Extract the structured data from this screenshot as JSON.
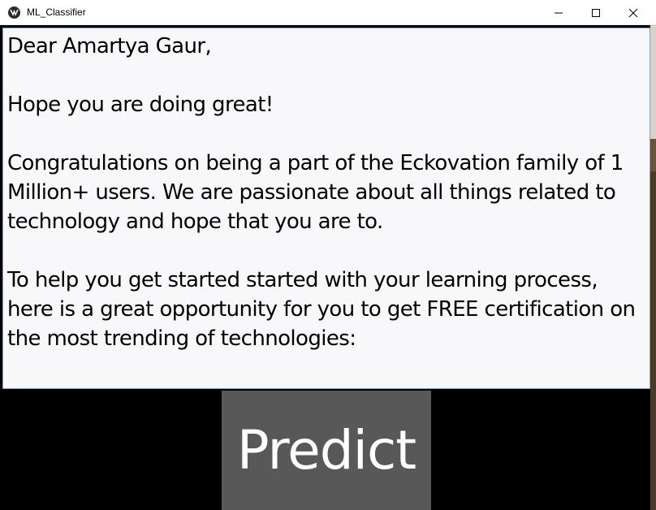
{
  "window": {
    "title": "ML_Classifier",
    "controls": {
      "minimize": "minimize-icon",
      "maximize": "maximize-icon",
      "close": "close-icon"
    }
  },
  "email_input": {
    "value": "Dear Amartya Gaur,\n\nHope you are doing great!\n\nCongratulations on being a part of the Eckovation family of 1 Million+ users. We are passionate about all things related to technology and hope that you are to.\n\nTo help you get started started with your learning process, here is a great opportunity for you to get FREE certification on the most trending of technologies:"
  },
  "predict_button": {
    "label": "Predict"
  },
  "colors": {
    "window_background": "#000000",
    "text_area_background": "#f8f8fa",
    "text_area_border": "#7fa2cc",
    "button_background": "#585858",
    "button_text": "#ffffff"
  }
}
